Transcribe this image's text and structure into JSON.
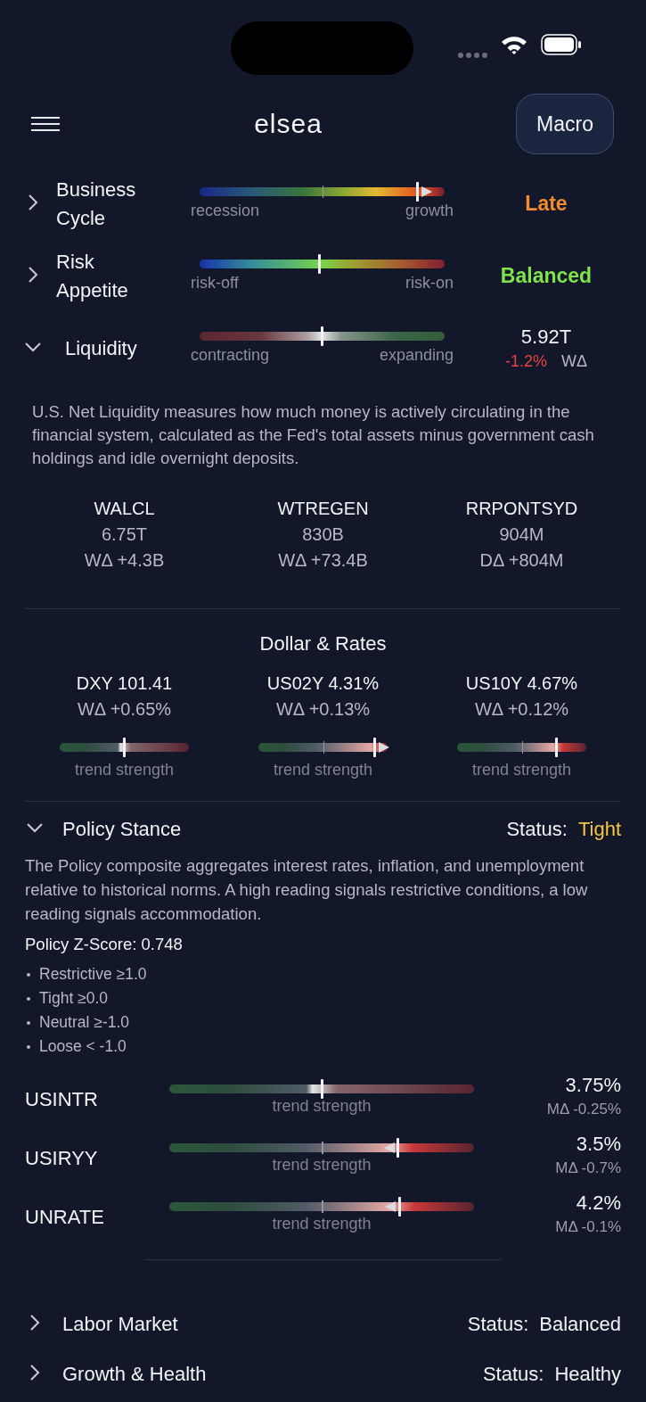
{
  "header": {
    "logo": "elsea",
    "mode_button": "Macro"
  },
  "indicators": [
    {
      "kind": "cycle",
      "title": "Business Cycle",
      "expanded": false,
      "level": 0.89,
      "arrow_right": true,
      "arrow_left": false,
      "low_label": "recession",
      "high_label": "growth",
      "status": {
        "text": "Late",
        "color": "#f28a30"
      }
    },
    {
      "kind": "risk",
      "title": "Risk Appetite",
      "expanded": false,
      "level": 0.49,
      "arrow_right": false,
      "arrow_left": false,
      "low_label": "risk-off",
      "high_label": "risk-on",
      "status": {
        "text": "Balanced",
        "color": "#7fe34c"
      }
    },
    {
      "kind": "liquidity",
      "title": "Liquidity",
      "expanded": true,
      "level": 0.5,
      "arrow_right": false,
      "arrow_left": false,
      "low_label": "contracting",
      "high_label": "expanding",
      "value": "5.92T",
      "change": "-1.2%",
      "change_unit": "WΔ"
    }
  ],
  "liquidity_detail": {
    "description": "U.S. Net Liquidity measures how much money is actively circulating in the financial system, calculated as the Fed's total assets minus government cash holdings and idle overnight deposits.",
    "series": [
      {
        "name": "WALCL",
        "value": "6.75T",
        "change": "WΔ +4.3B"
      },
      {
        "name": "WTREGEN",
        "value": "830B",
        "change": "WΔ +73.4B"
      },
      {
        "name": "RRPONTSYD",
        "value": "904M",
        "change": "DΔ +804M"
      }
    ]
  },
  "dollar_rates": {
    "title": "Dollar & Rates",
    "items": [
      {
        "label": "DXY 101.41",
        "change": "WΔ +0.65%",
        "level": 0.5,
        "arrow_right": false,
        "arrow_left": false,
        "caption": "trend strength"
      },
      {
        "label": "US02Y 4.31%",
        "change": "WΔ +0.13%",
        "level": 0.9,
        "arrow_right": true,
        "arrow_left": false,
        "caption": "trend strength"
      },
      {
        "label": "US10Y 4.67%",
        "change": "WΔ +0.12%",
        "level": 0.77,
        "arrow_right": false,
        "arrow_left": false,
        "caption": "trend strength"
      }
    ]
  },
  "policy": {
    "title": "Policy Stance",
    "expanded": true,
    "status_label": "Status:",
    "status": {
      "text": "Tight",
      "color": "#f5c542"
    },
    "description": "The Policy composite aggregates interest rates, inflation, and unemployment relative to historical norms. A high reading signals restrictive conditions, a low reading signals accommodation.",
    "zscore": "Policy Z-Score: 0.748",
    "thresholds": [
      "Restrictive ≥1.0",
      "Tight ≥0.0",
      "Neutral ≥-1.0",
      "Loose < -1.0"
    ],
    "rows": [
      {
        "name": "USINTR",
        "level": 0.5,
        "arrow_right": false,
        "arrow_left": false,
        "caption": "trend strength",
        "value": "3.75%",
        "change": "MΔ -0.25%"
      },
      {
        "name": "USIRYY",
        "level": 0.75,
        "arrow_right": false,
        "arrow_left": true,
        "caption": "trend strength",
        "value": "3.5%",
        "change": "MΔ -0.7%"
      },
      {
        "name": "UNRATE",
        "level": 0.755,
        "arrow_right": false,
        "arrow_left": true,
        "caption": "trend strength",
        "value": "4.2%",
        "change": "MΔ -0.1%"
      }
    ]
  },
  "sections": [
    {
      "title": "Labor Market",
      "expanded": false,
      "status_label": "Status:",
      "status": "Balanced"
    },
    {
      "title": "Growth & Health",
      "expanded": false,
      "status_label": "Status:",
      "status": "Healthy"
    }
  ]
}
